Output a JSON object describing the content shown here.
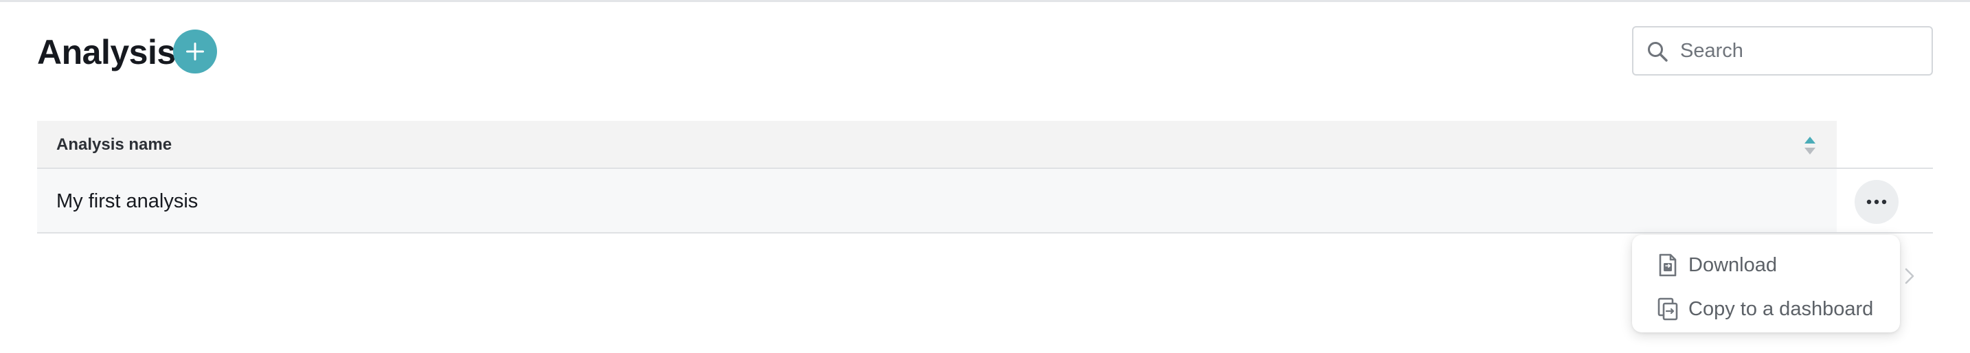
{
  "header": {
    "title": "Analysis",
    "add_icon": "plus-icon"
  },
  "search": {
    "placeholder": "Search",
    "value": "",
    "icon": "search-icon"
  },
  "table": {
    "columns": [
      {
        "label": "Analysis name",
        "sort_icon": "sort-icon"
      }
    ],
    "rows": [
      {
        "name": "My first analysis",
        "actions_icon": "more-horizontal-icon"
      }
    ]
  },
  "pagination": {
    "next_icon": "chevron-right-icon"
  },
  "context_menu": {
    "items": [
      {
        "label": "Download",
        "icon": "file-download-icon"
      },
      {
        "label": "Copy to a dashboard",
        "icon": "copy-icon"
      }
    ]
  },
  "colors": {
    "accent": "#4aacb8",
    "header_bg": "#f3f3f3",
    "row_bg": "#f7f8f9"
  }
}
